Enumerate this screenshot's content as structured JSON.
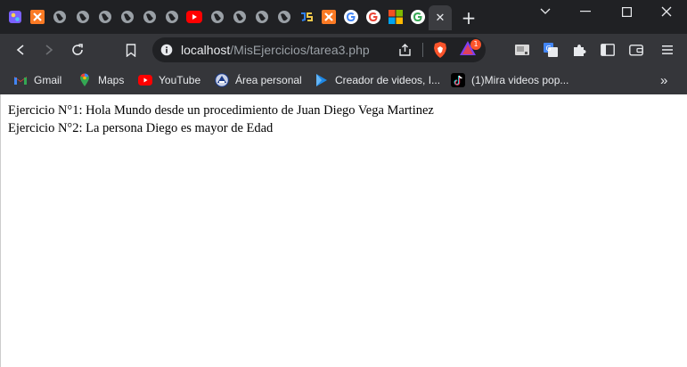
{
  "browser": {
    "tabs": [
      {
        "icon": "app-launcher-icon",
        "active": false
      },
      {
        "icon": "xampp-icon",
        "active": false
      },
      {
        "icon": "globe-icon",
        "active": false
      },
      {
        "icon": "globe-icon",
        "active": false
      },
      {
        "icon": "globe-icon",
        "active": false
      },
      {
        "icon": "globe-icon",
        "active": false
      },
      {
        "icon": "globe-icon",
        "active": false
      },
      {
        "icon": "globe-icon",
        "active": false
      },
      {
        "icon": "youtube-icon",
        "active": false
      },
      {
        "icon": "globe-icon",
        "active": false
      },
      {
        "icon": "globe-icon",
        "active": false
      },
      {
        "icon": "globe-icon",
        "active": false
      },
      {
        "icon": "js-icon",
        "active": false
      },
      {
        "icon": "xampp-icon",
        "active": false
      },
      {
        "icon": "google-icon",
        "active": false
      },
      {
        "icon": "google-icon",
        "active": false
      },
      {
        "icon": "microsoft-icon",
        "active": false
      },
      {
        "icon": "google-icon",
        "active": false
      },
      {
        "icon": "close-icon",
        "active": true
      }
    ],
    "new_tab_label": "+",
    "address": {
      "host": "localhost",
      "path": "/MisEjercicios/tarea3.php"
    },
    "brave_badge": "1",
    "bookmarks": [
      {
        "label": "Gmail",
        "icon": "gmail-icon"
      },
      {
        "label": "Maps",
        "icon": "maps-icon"
      },
      {
        "label": "YouTube",
        "icon": "youtube-icon"
      },
      {
        "label": "Área personal",
        "icon": "school-emblem-icon"
      },
      {
        "label": "Creador de videos, I...",
        "icon": "play-triangle-icon"
      },
      {
        "label": "(1)Mira videos pop...",
        "icon": "tiktok-icon"
      }
    ],
    "bookmarks_overflow": "»"
  },
  "page": {
    "lines": [
      "Ejercicio N°1: Hola Mundo desde un procedimiento de Juan Diego Vega Martinez",
      "Ejercicio N°2: La persona Diego es mayor de Edad"
    ]
  },
  "colors": {
    "tabstrip": "#202124",
    "toolbar": "#35363a",
    "omnibox": "#202124",
    "page_bg": "#ffffff",
    "youtube_red": "#ff0000",
    "xampp_orange": "#fb7a24",
    "brave_orange": "#fb542b"
  }
}
